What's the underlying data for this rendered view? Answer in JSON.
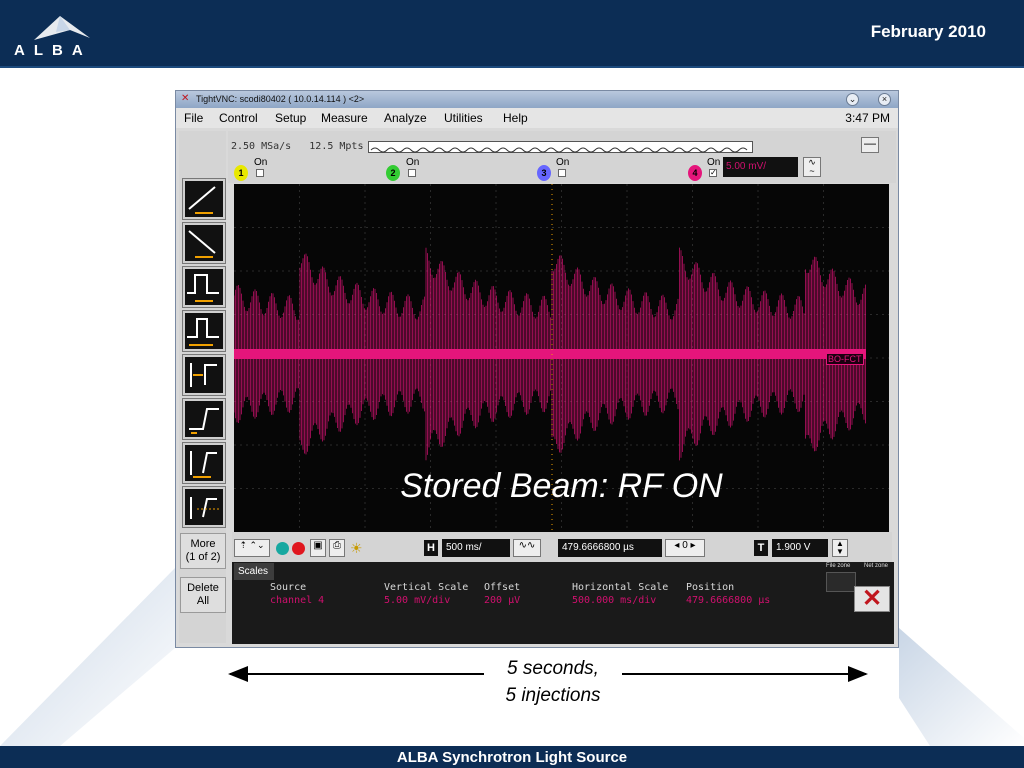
{
  "header": {
    "logo_text": "ALBA",
    "date": "February 2010"
  },
  "footer": {
    "text": "ALBA Synchrotron Light Source"
  },
  "vnc": {
    "title": "TightVNC: scodi80402 ( 10.0.14.114 ) <2>",
    "menu": [
      "File",
      "Control",
      "Setup",
      "Measure",
      "Analyze",
      "Utilities",
      "Help"
    ],
    "clock": "3:47 PM"
  },
  "scope": {
    "sample_rate": "2.50 MSa/s",
    "memory": "12.5 Mpts",
    "channels": [
      {
        "num": "1",
        "label": "On",
        "color": "#e8e800"
      },
      {
        "num": "2",
        "label": "On",
        "color": "#33cc33"
      },
      {
        "num": "3",
        "label": "On",
        "color": "#6666ff"
      },
      {
        "num": "4",
        "label": "On",
        "color": "#e5157b"
      }
    ],
    "ch4_scale": "5.00 mV/",
    "side_more": [
      "More",
      "(1 of 2)"
    ],
    "side_delete": [
      "Delete",
      "All"
    ],
    "channel_marker": "BO-FCT",
    "overlay_title": "Stored Beam: RF ON",
    "horizontal_letter": "H",
    "horizontal_field": "500 ms/",
    "position_field": "479.6666800 µs",
    "position_stepper": "0",
    "trigger_letter": "T",
    "trigger_field": "1.900 V",
    "tab": "Scales",
    "info_headers": [
      "Source",
      "Vertical Scale",
      "Offset",
      "Horizontal Scale",
      "Position"
    ],
    "info_values": [
      "channel 4",
      "5.00 mV/div",
      "200 µV",
      "500.000 ms/div",
      "479.6666800 µs"
    ],
    "file_zone": [
      "File zone",
      "Net zone"
    ],
    "trace_color": "#e5157b"
  },
  "annotation": {
    "line1": "5 seconds,",
    "line2": "5 injections"
  }
}
